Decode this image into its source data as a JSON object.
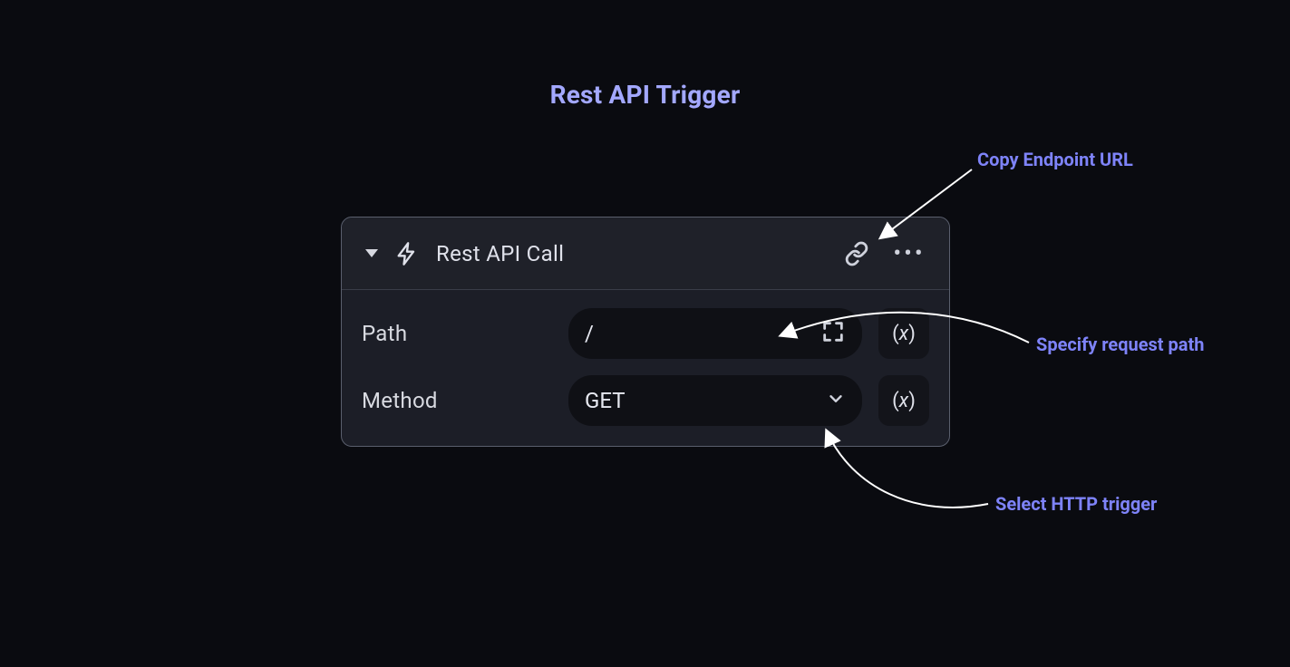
{
  "title": "Rest API Trigger",
  "panel": {
    "header": {
      "title": "Rest API Call"
    },
    "fields": {
      "path": {
        "label": "Path",
        "value": "/"
      },
      "method": {
        "label": "Method",
        "value": "GET"
      }
    },
    "variable_glyph": {
      "open": "(",
      "x": "x",
      "close": ")"
    }
  },
  "annotations": {
    "copy_endpoint": "Copy Endpoint URL",
    "specify_path": "Specify request path",
    "select_trigger": "Select HTTP trigger"
  }
}
